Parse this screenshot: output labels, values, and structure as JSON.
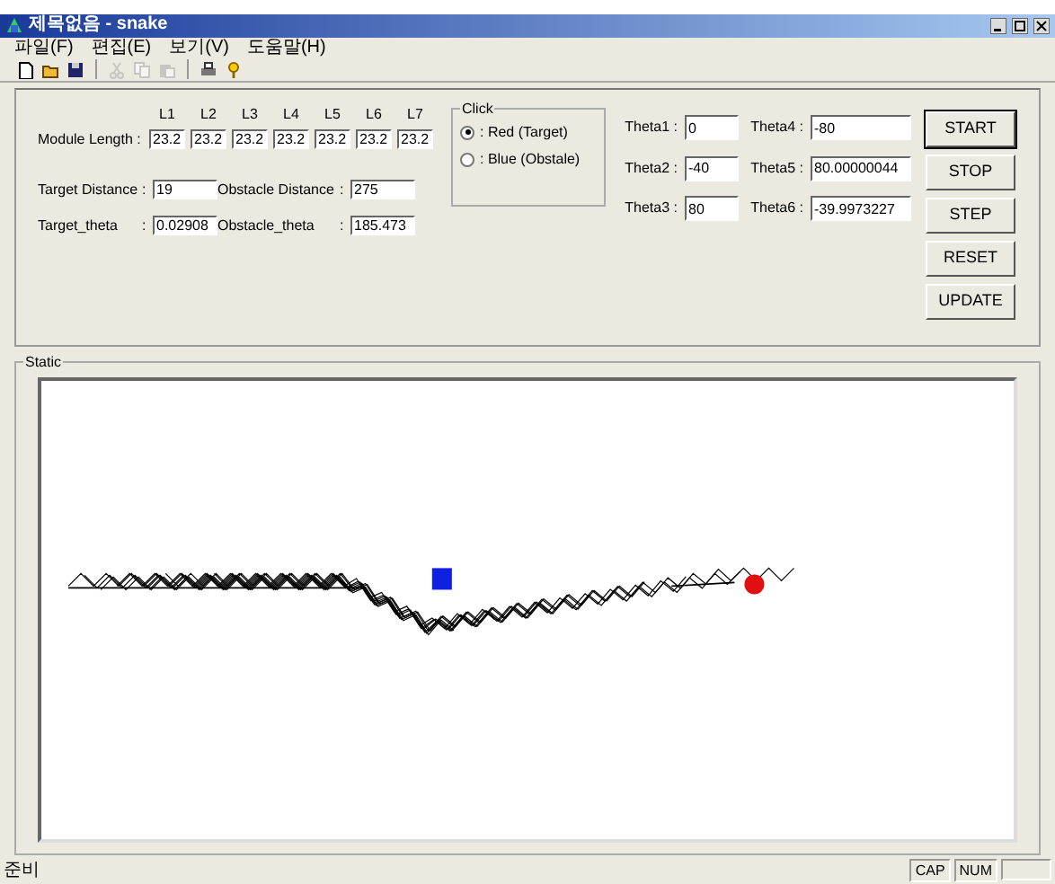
{
  "window": {
    "title": "제목없음 - snake"
  },
  "menu": [
    "파일(F)",
    "편집(E)",
    "보기(V)",
    "도움말(H)"
  ],
  "toolbar": [
    {
      "kind": "new",
      "disabled": false
    },
    {
      "kind": "open",
      "disabled": false
    },
    {
      "kind": "save",
      "disabled": false
    },
    {
      "kind": "separator"
    },
    {
      "kind": "cut",
      "disabled": true
    },
    {
      "kind": "copy",
      "disabled": true
    },
    {
      "kind": "paste",
      "disabled": true
    },
    {
      "kind": "separator"
    },
    {
      "kind": "print",
      "disabled": false
    },
    {
      "kind": "help",
      "disabled": false
    }
  ],
  "module_length": {
    "label": "Module Length :",
    "columns": [
      "L1",
      "L2",
      "L3",
      "L4",
      "L5",
      "L6",
      "L7"
    ],
    "values": [
      "23.2",
      "23.2",
      "23.2",
      "23.2",
      "23.2",
      "23.2",
      "23.2"
    ]
  },
  "measures": [
    {
      "label": "Target Distance",
      "colon": ":",
      "value": "19"
    },
    {
      "label": "Obstacle Distance",
      "colon": ":",
      "value": "275"
    },
    {
      "label": "Target_theta",
      "colon": ":",
      "value": "0.02908"
    },
    {
      "label": "Obstacle_theta",
      "colon": ":",
      "value": "185.473"
    }
  ],
  "click_group": {
    "legend": "Click",
    "options": [
      {
        "label": ": Red (Target)",
        "selected": true
      },
      {
        "label": ": Blue (Obstale)",
        "selected": false
      }
    ]
  },
  "thetas": [
    {
      "label": "Theta1 :",
      "value": "0"
    },
    {
      "label": "Theta2 :",
      "value": "-40"
    },
    {
      "label": "Theta3 :",
      "value": "80"
    },
    {
      "label": "Theta4 :",
      "value": "-80"
    },
    {
      "label": "Theta5 :",
      "value": "80.00000044"
    },
    {
      "label": "Theta6 :",
      "value": "-39.9973227"
    }
  ],
  "buttons": [
    {
      "label": "START",
      "default": true
    },
    {
      "label": "STOP",
      "default": false
    },
    {
      "label": "STEP",
      "default": false
    },
    {
      "label": "RESET",
      "default": false
    },
    {
      "label": "UPDATE",
      "default": false
    }
  ],
  "static_group": {
    "legend": "Static"
  },
  "status_bar": {
    "message": "준비",
    "indicators": [
      "CAP",
      "NUM"
    ]
  }
}
